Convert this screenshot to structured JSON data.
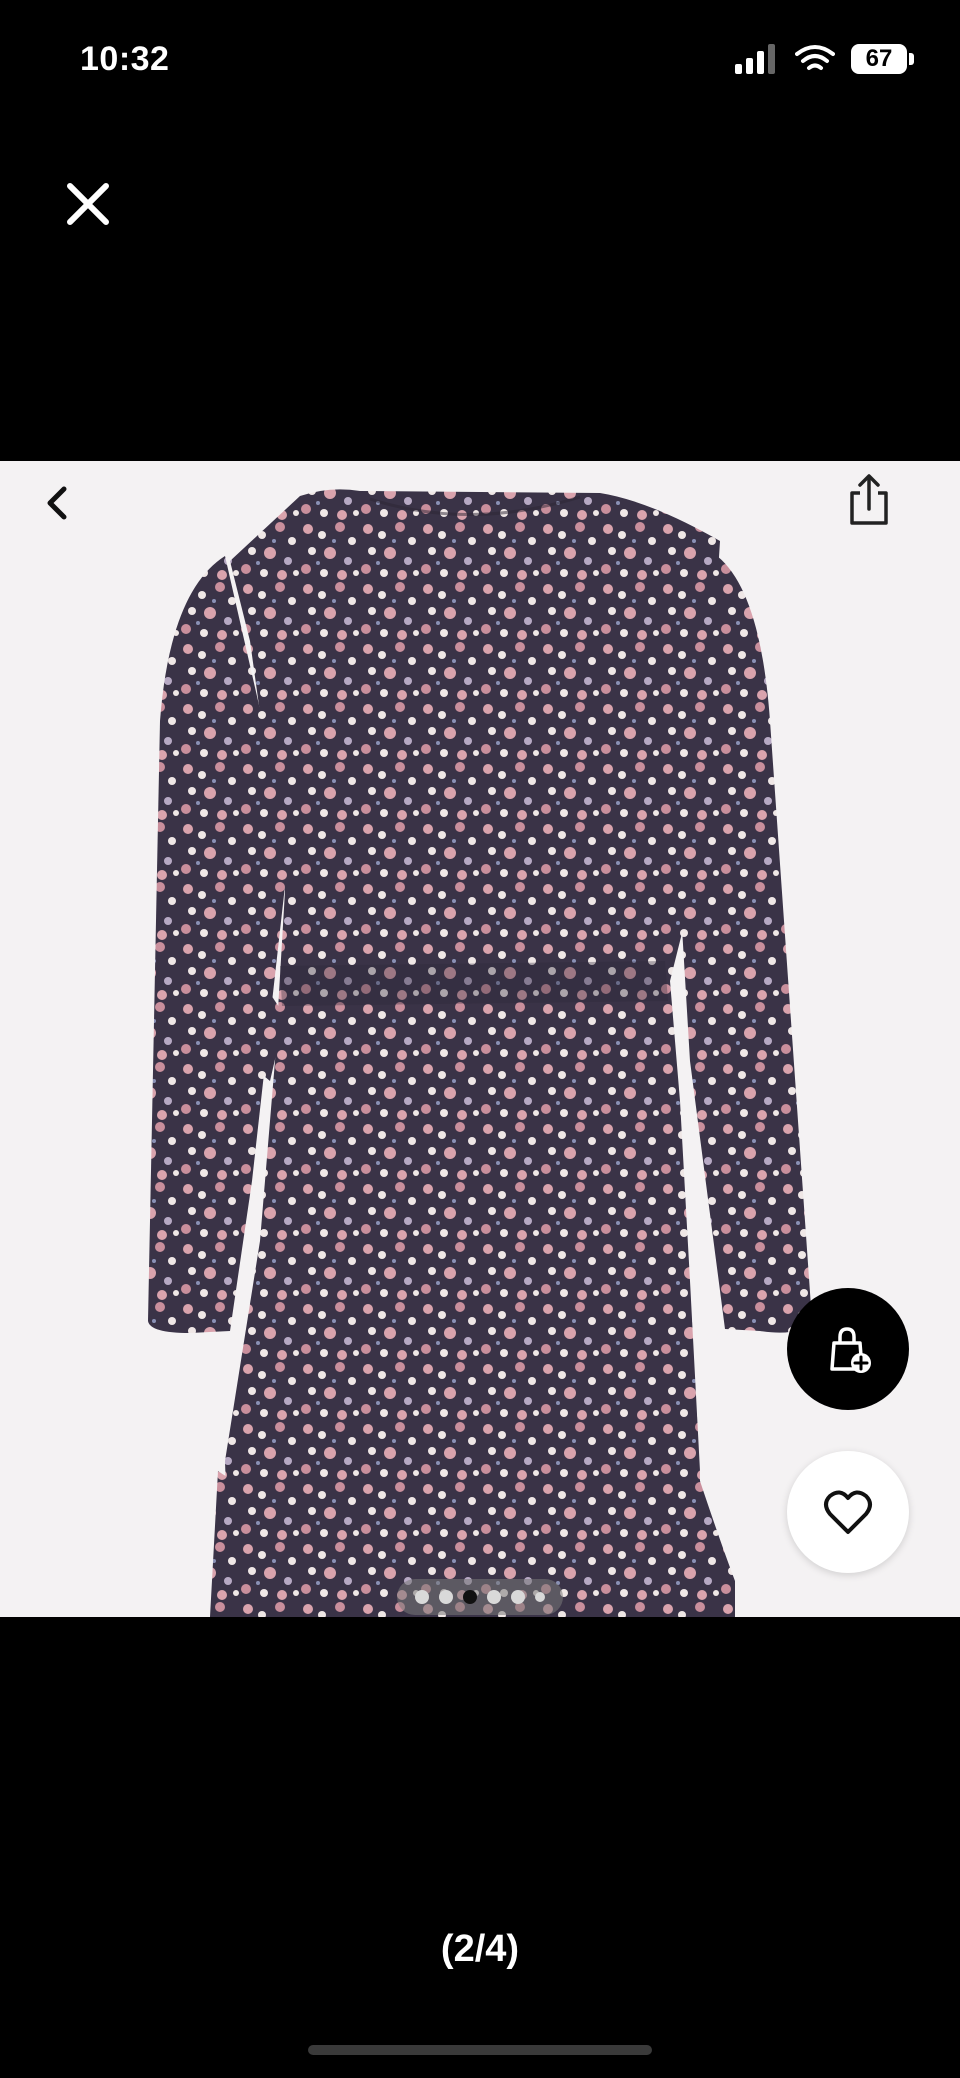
{
  "status_bar": {
    "time": "10:32",
    "battery": "67",
    "icons": [
      "signal-icon",
      "wifi-icon",
      "battery-icon"
    ]
  },
  "viewer": {
    "close_icon": "close-icon",
    "back_icon": "chevron-left-icon",
    "share_icon": "share-icon",
    "add_to_bag_icon": "bag-plus-icon",
    "wishlist_icon": "heart-icon",
    "image": "floral-print-wrap-dress-back-view",
    "pager": {
      "count": 6,
      "active_index": 2
    },
    "counter": "(2/4)"
  },
  "colors": {
    "background": "#000000",
    "viewer_bg": "#f4f2f3",
    "dress_base": "#3a3347",
    "flower_pink": "#d9a3ad",
    "flower_white": "#efe7e6"
  }
}
